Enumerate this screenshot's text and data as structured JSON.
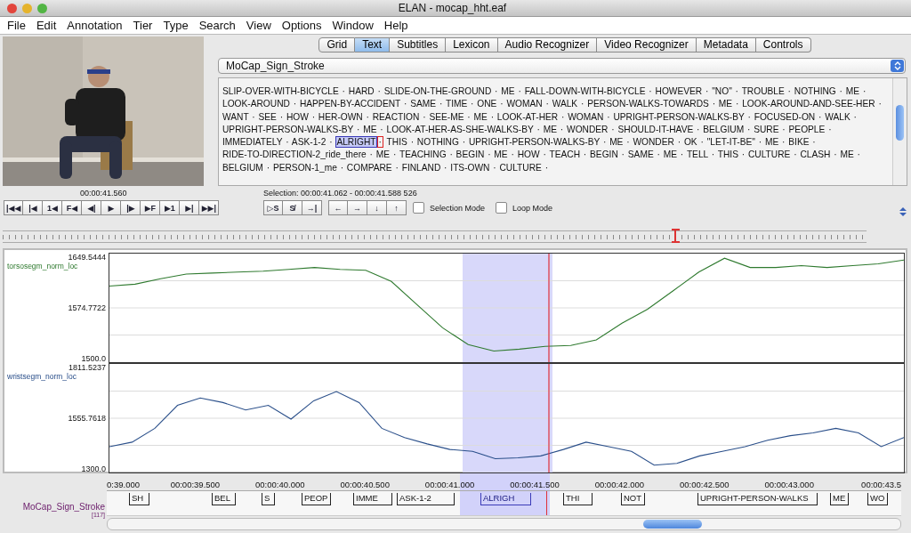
{
  "window": {
    "title": "ELAN - mocap_hht.eaf"
  },
  "menu": [
    "File",
    "Edit",
    "Annotation",
    "Tier",
    "Type",
    "Search",
    "View",
    "Options",
    "Window",
    "Help"
  ],
  "video": {
    "time": "00:00:41.560"
  },
  "tabs": [
    {
      "label": "Grid",
      "selected": false
    },
    {
      "label": "Text",
      "selected": true
    },
    {
      "label": "Subtitles",
      "selected": false
    },
    {
      "label": "Lexicon",
      "selected": false
    },
    {
      "label": "Audio Recognizer",
      "selected": false
    },
    {
      "label": "Video Recognizer",
      "selected": false
    },
    {
      "label": "Metadata",
      "selected": false
    },
    {
      "label": "Controls",
      "selected": false
    }
  ],
  "tier_select": {
    "value": "MoCap_Sign_Stroke"
  },
  "text_view": {
    "lines": [
      [
        {
          "kind": "plain",
          "text": "SLIP-OVER-WITH-BICYCLE · HARD · SLIDE-ON-THE-GROUND · ME · FALL-DOWN-WITH-BICYCLE · HOWEVER · \"NO\" · TROUBLE · NOTHING · ME ·"
        }
      ],
      [
        {
          "kind": "plain",
          "text": "LOOK-AROUND · HAPPEN-BY-ACCIDENT · SAME · TIME · ONE · WOMAN · WALK · PERSON-WALKS-TOWARDS · ME · LOOK-AROUND-AND-SEE-HER ·"
        }
      ],
      [
        {
          "kind": "plain",
          "text": "WANT · SEE · HOW · HER-OWN · REACTION · SEE-ME · ME · LOOK-AT-HER · WOMAN · UPRIGHT-PERSON-WALKS-BY · FOCUSED-ON · WALK ·"
        }
      ],
      [
        {
          "kind": "plain",
          "text": "UPRIGHT-PERSON-WALKS-BY · ME · LOOK-AT-HER-AS-SHE-WALKS-BY · ME · WONDER · SHOULD-IT-HAVE · BELGIUM · SURE · PEOPLE ·"
        }
      ],
      [
        {
          "kind": "plain",
          "text": "IMMEDIATELY · ASK-1-2 · "
        },
        {
          "kind": "selected",
          "text": "ALRIGHT"
        },
        {
          "kind": "current",
          "text": "·"
        },
        {
          "kind": "plain",
          "text": " THIS · NOTHING · UPRIGHT-PERSON-WALKS-BY · ME · WONDER · OK · \"LET-IT-BE\" · ME · BIKE ·"
        }
      ],
      [
        {
          "kind": "plain",
          "text": "RIDE-TO-DIRECTION-2_ride_there · ME · TEACHING · BEGIN · ME · HOW · TEACH · BEGIN · SAME · ME · TELL · THIS · CULTURE · CLASH · ME ·"
        }
      ],
      [
        {
          "kind": "plain",
          "text": "BELGIUM · PERSON-1_me · COMPARE · FINLAND · ITS-OWN · CULTURE ·"
        }
      ]
    ]
  },
  "selection_info": "Selection: 00:00:41.062 - 00:00:41.588  526",
  "player_buttons": [
    {
      "text": "|◀◀"
    },
    {
      "text": "|◀"
    },
    {
      "text": "1◀"
    },
    {
      "text": "F◀"
    },
    {
      "text": "◀|"
    },
    {
      "text": "▶"
    },
    {
      "text": "|▶"
    },
    {
      "text": "▶F"
    },
    {
      "text": "▶1"
    },
    {
      "text": "▶|"
    },
    {
      "text": "▶▶|"
    }
  ],
  "selection_buttons": [
    {
      "text": "▷S"
    },
    {
      "text": "S̸"
    },
    {
      "text": "→|"
    }
  ],
  "nav_buttons": [
    {
      "text": "←"
    },
    {
      "text": "→"
    },
    {
      "text": "↓"
    },
    {
      "text": "↑"
    }
  ],
  "checkboxes": [
    {
      "label": "Selection Mode",
      "checked": false
    },
    {
      "label": "Loop Mode",
      "checked": false
    }
  ],
  "graphs": [
    {
      "label": "torsosegm_norm_loc",
      "y_labels": [
        "1649.5444",
        "1574.7722",
        "1500.0"
      ]
    },
    {
      "label": "wristsegm_norm_loc",
      "y_labels": [
        "1811.5237",
        "1555.7618",
        "1300.0"
      ]
    }
  ],
  "timeline": {
    "ticks": [
      "0:39.000",
      "00:00:39.500",
      "00:00:40.000",
      "00:00:40.500",
      "00:00:41.000",
      "00:00:41.500",
      "00:00:42.000",
      "00:00:42.500",
      "00:00:43.000",
      "00:00:43.5"
    ],
    "tier": {
      "name": "MoCap_Sign_Stroke",
      "count": "[117]",
      "annotations": [
        {
          "text": "SH",
          "selected": false
        },
        {
          "text": "BEL",
          "selected": false
        },
        {
          "text": "S",
          "selected": false
        },
        {
          "text": "PEOP",
          "selected": false
        },
        {
          "text": "IMME",
          "selected": false
        },
        {
          "text": "ASK-1-2",
          "selected": false
        },
        {
          "text": "ALRIGH",
          "selected": true
        },
        {
          "text": "THI",
          "selected": false
        },
        {
          "text": "NOT",
          "selected": false
        },
        {
          "text": "UPRIGHT-PERSON-WALKS",
          "selected": false
        },
        {
          "text": "ME",
          "selected": false
        },
        {
          "text": "WO",
          "selected": false
        }
      ]
    }
  }
}
